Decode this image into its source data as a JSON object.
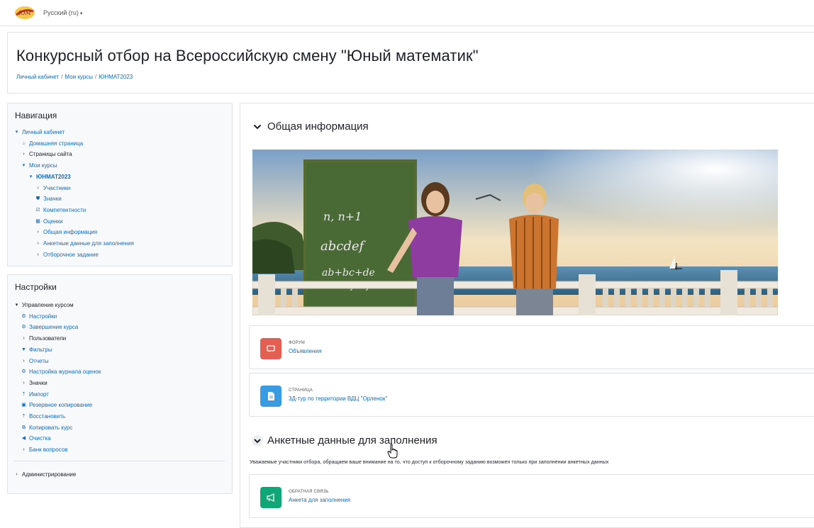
{
  "topbar": {
    "language_label": "Русский (ru)",
    "language_caret": "▾"
  },
  "header": {
    "title": "Конкурсный отбор на Всероссийскую смену \"Юный математик\"",
    "breadcrumb": [
      "Личный кабинет",
      "Мои курсы",
      "ЮНМАТ2023"
    ],
    "breadcrumb_separator": "/"
  },
  "navigation": {
    "title": "Навигация",
    "items": [
      {
        "label": "Личный кабинет",
        "icon": "chevron-down-icon"
      },
      {
        "label": "Домашняя страница",
        "icon": "home-icon"
      },
      {
        "label": "Страницы сайта",
        "icon": "chevron-right-icon"
      },
      {
        "label": "Мои курсы",
        "icon": "chevron-down-icon"
      },
      {
        "label": "ЮНМАТ2023",
        "icon": "chevron-down-icon"
      },
      {
        "label": "Участники",
        "icon": "chevron-right-icon"
      },
      {
        "label": "Значки",
        "icon": "shield-icon"
      },
      {
        "label": "Компетентности",
        "icon": "checkbox-icon"
      },
      {
        "label": "Оценки",
        "icon": "table-icon"
      },
      {
        "label": "Общая информация",
        "icon": "chevron-right-icon"
      },
      {
        "label": "Анкетные данные для заполнения",
        "icon": "chevron-right-icon"
      },
      {
        "label": "Отборочное задание",
        "icon": "chevron-right-icon"
      }
    ]
  },
  "settings": {
    "title": "Настройки",
    "items": [
      {
        "label": "Управление курсом",
        "icon": "chevron-down-icon"
      },
      {
        "label": "Настройки",
        "icon": "gear-icon"
      },
      {
        "label": "Завершение курса",
        "icon": "gear-icon"
      },
      {
        "label": "Пользователи",
        "icon": "chevron-right-icon"
      },
      {
        "label": "Фильтры",
        "icon": "filter-icon"
      },
      {
        "label": "Отчеты",
        "icon": "chevron-right-icon"
      },
      {
        "label": "Настройка журнала оценок",
        "icon": "gear-icon"
      },
      {
        "label": "Значки",
        "icon": "chevron-right-icon"
      },
      {
        "label": "Импорт",
        "icon": "upload-icon"
      },
      {
        "label": "Резервное копирование",
        "icon": "backup-icon"
      },
      {
        "label": "Восстановить",
        "icon": "upload-icon"
      },
      {
        "label": "Копировать курс",
        "icon": "copy-icon"
      },
      {
        "label": "Очистка",
        "icon": "arrow-left-icon"
      },
      {
        "label": "Банк вопросов",
        "icon": "chevron-right-icon"
      }
    ],
    "admin_label": "Администрирование"
  },
  "main": {
    "section1_title": "Общая информация",
    "activities": [
      {
        "type": "ФОРУМ",
        "name": "Объявления",
        "color": "#e35f51",
        "icon": "forum-icon"
      },
      {
        "type": "СТРАНИЦА",
        "name": "3Д-тур по территории ВДЦ \"Орленок\"",
        "color": "#399be2",
        "icon": "page-icon"
      }
    ],
    "section2_title": "Анкетные данные для заполнения",
    "section2_notice": "Уважаемые участники отбора, обращаем ваше внимание на то, что доступ к отборочному заданию возможен только при заполнении анкетных данных",
    "feedback": {
      "type": "ОБРАТНАЯ СВЯЗЬ",
      "name": "Анкета для заполнения",
      "color": "#11a676",
      "icon": "megaphone-icon"
    }
  },
  "banner": {
    "board_text_line1": "n, n+1",
    "board_text_line2": "abcdef",
    "board_text_line3": "ab+bc+de",
    "board_text_line4": "=de+fcdf"
  }
}
